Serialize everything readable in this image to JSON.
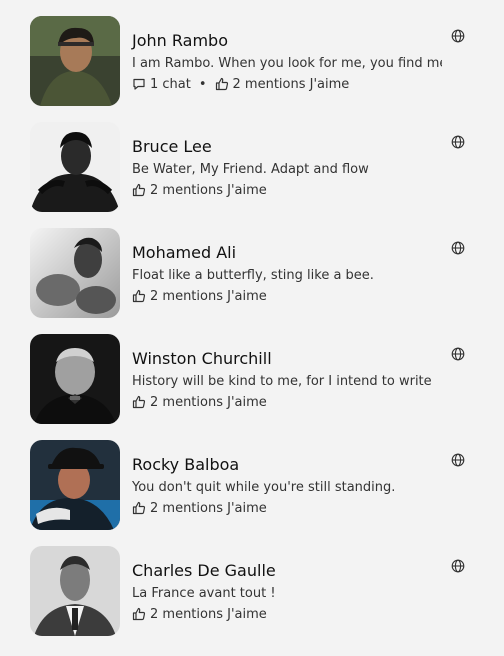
{
  "icons": {
    "like": "thumbs-up-icon",
    "chat": "chat-bubble-icon",
    "visibility": "globe-icon"
  },
  "characters": [
    {
      "name": "John Rambo",
      "quote": "I am Rambo. When you look for me, you find me.",
      "chats": "1 chat",
      "separator": "•",
      "likes": "2 mentions J'aime",
      "avatar_colors": [
        "#3f4a2c",
        "#a77a58"
      ]
    },
    {
      "name": "Bruce Lee",
      "quote": "Be Water, My Friend. Adapt and flow",
      "likes": "2 mentions J'aime",
      "avatar_colors": [
        "#f2f2f2",
        "#1a1a1a"
      ]
    },
    {
      "name": "Mohamed Ali",
      "quote": "Float like a butterfly, sting like a bee.",
      "likes": "2 mentions J'aime",
      "avatar_colors": [
        "#dcdcdc",
        "#5c5c5c"
      ]
    },
    {
      "name": "Winston Churchill",
      "quote": "History will be kind to me, for I intend to write",
      "likes": "2 mentions J'aime",
      "avatar_colors": [
        "#1c1c1c",
        "#9a9a9a"
      ]
    },
    {
      "name": "Rocky Balboa",
      "quote": "You don't quit while you're still standing.",
      "likes": "2 mentions J'aime",
      "avatar_colors": [
        "#1d2b3a",
        "#b07055"
      ]
    },
    {
      "name": "Charles De Gaulle",
      "quote": "La France avant tout !",
      "likes": "2 mentions J'aime",
      "avatar_colors": [
        "#d4d4d4",
        "#4a4a4a"
      ]
    }
  ]
}
